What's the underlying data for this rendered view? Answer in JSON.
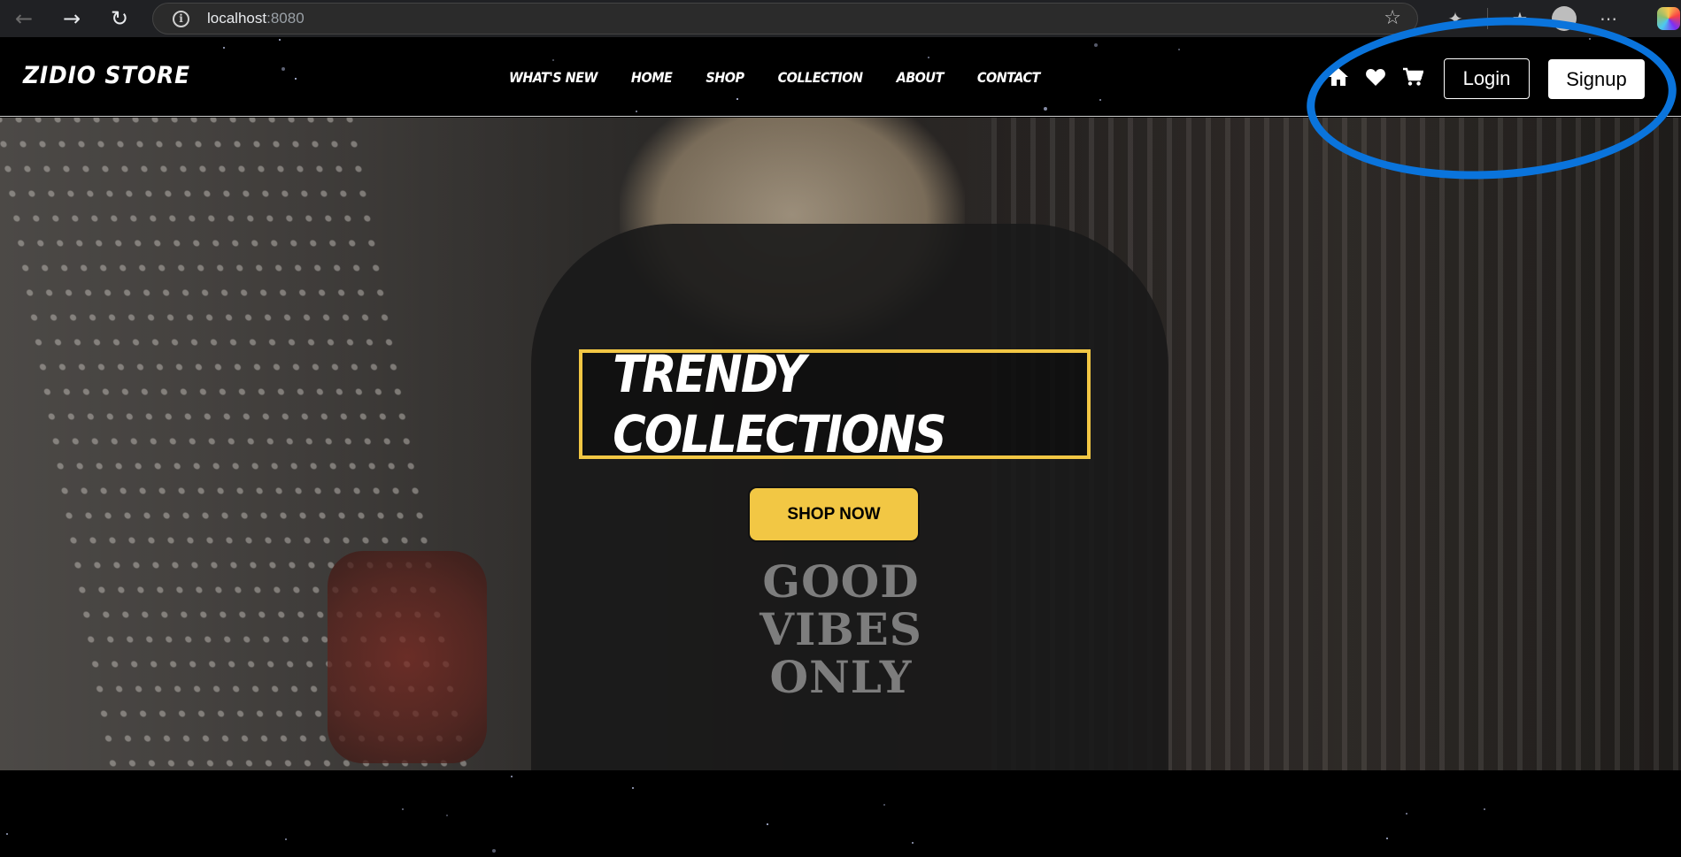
{
  "browser": {
    "url_host": "localhost",
    "url_port": ":8080"
  },
  "site": {
    "logo": "ZIDIO STORE",
    "nav": [
      "WHAT'S NEW",
      "HOME",
      "SHOP",
      "COLLECTION",
      "ABOUT",
      "CONTACT"
    ],
    "login_label": "Login",
    "signup_label": "Signup"
  },
  "hero": {
    "title": "TRENDY COLLECTIONS",
    "button_label": "SHOP NOW",
    "shirt_text": "GOOD VIBES ONLY"
  },
  "colors": {
    "accent": "#f2c744",
    "highlight": "#0a74dc",
    "background": "#000000"
  }
}
